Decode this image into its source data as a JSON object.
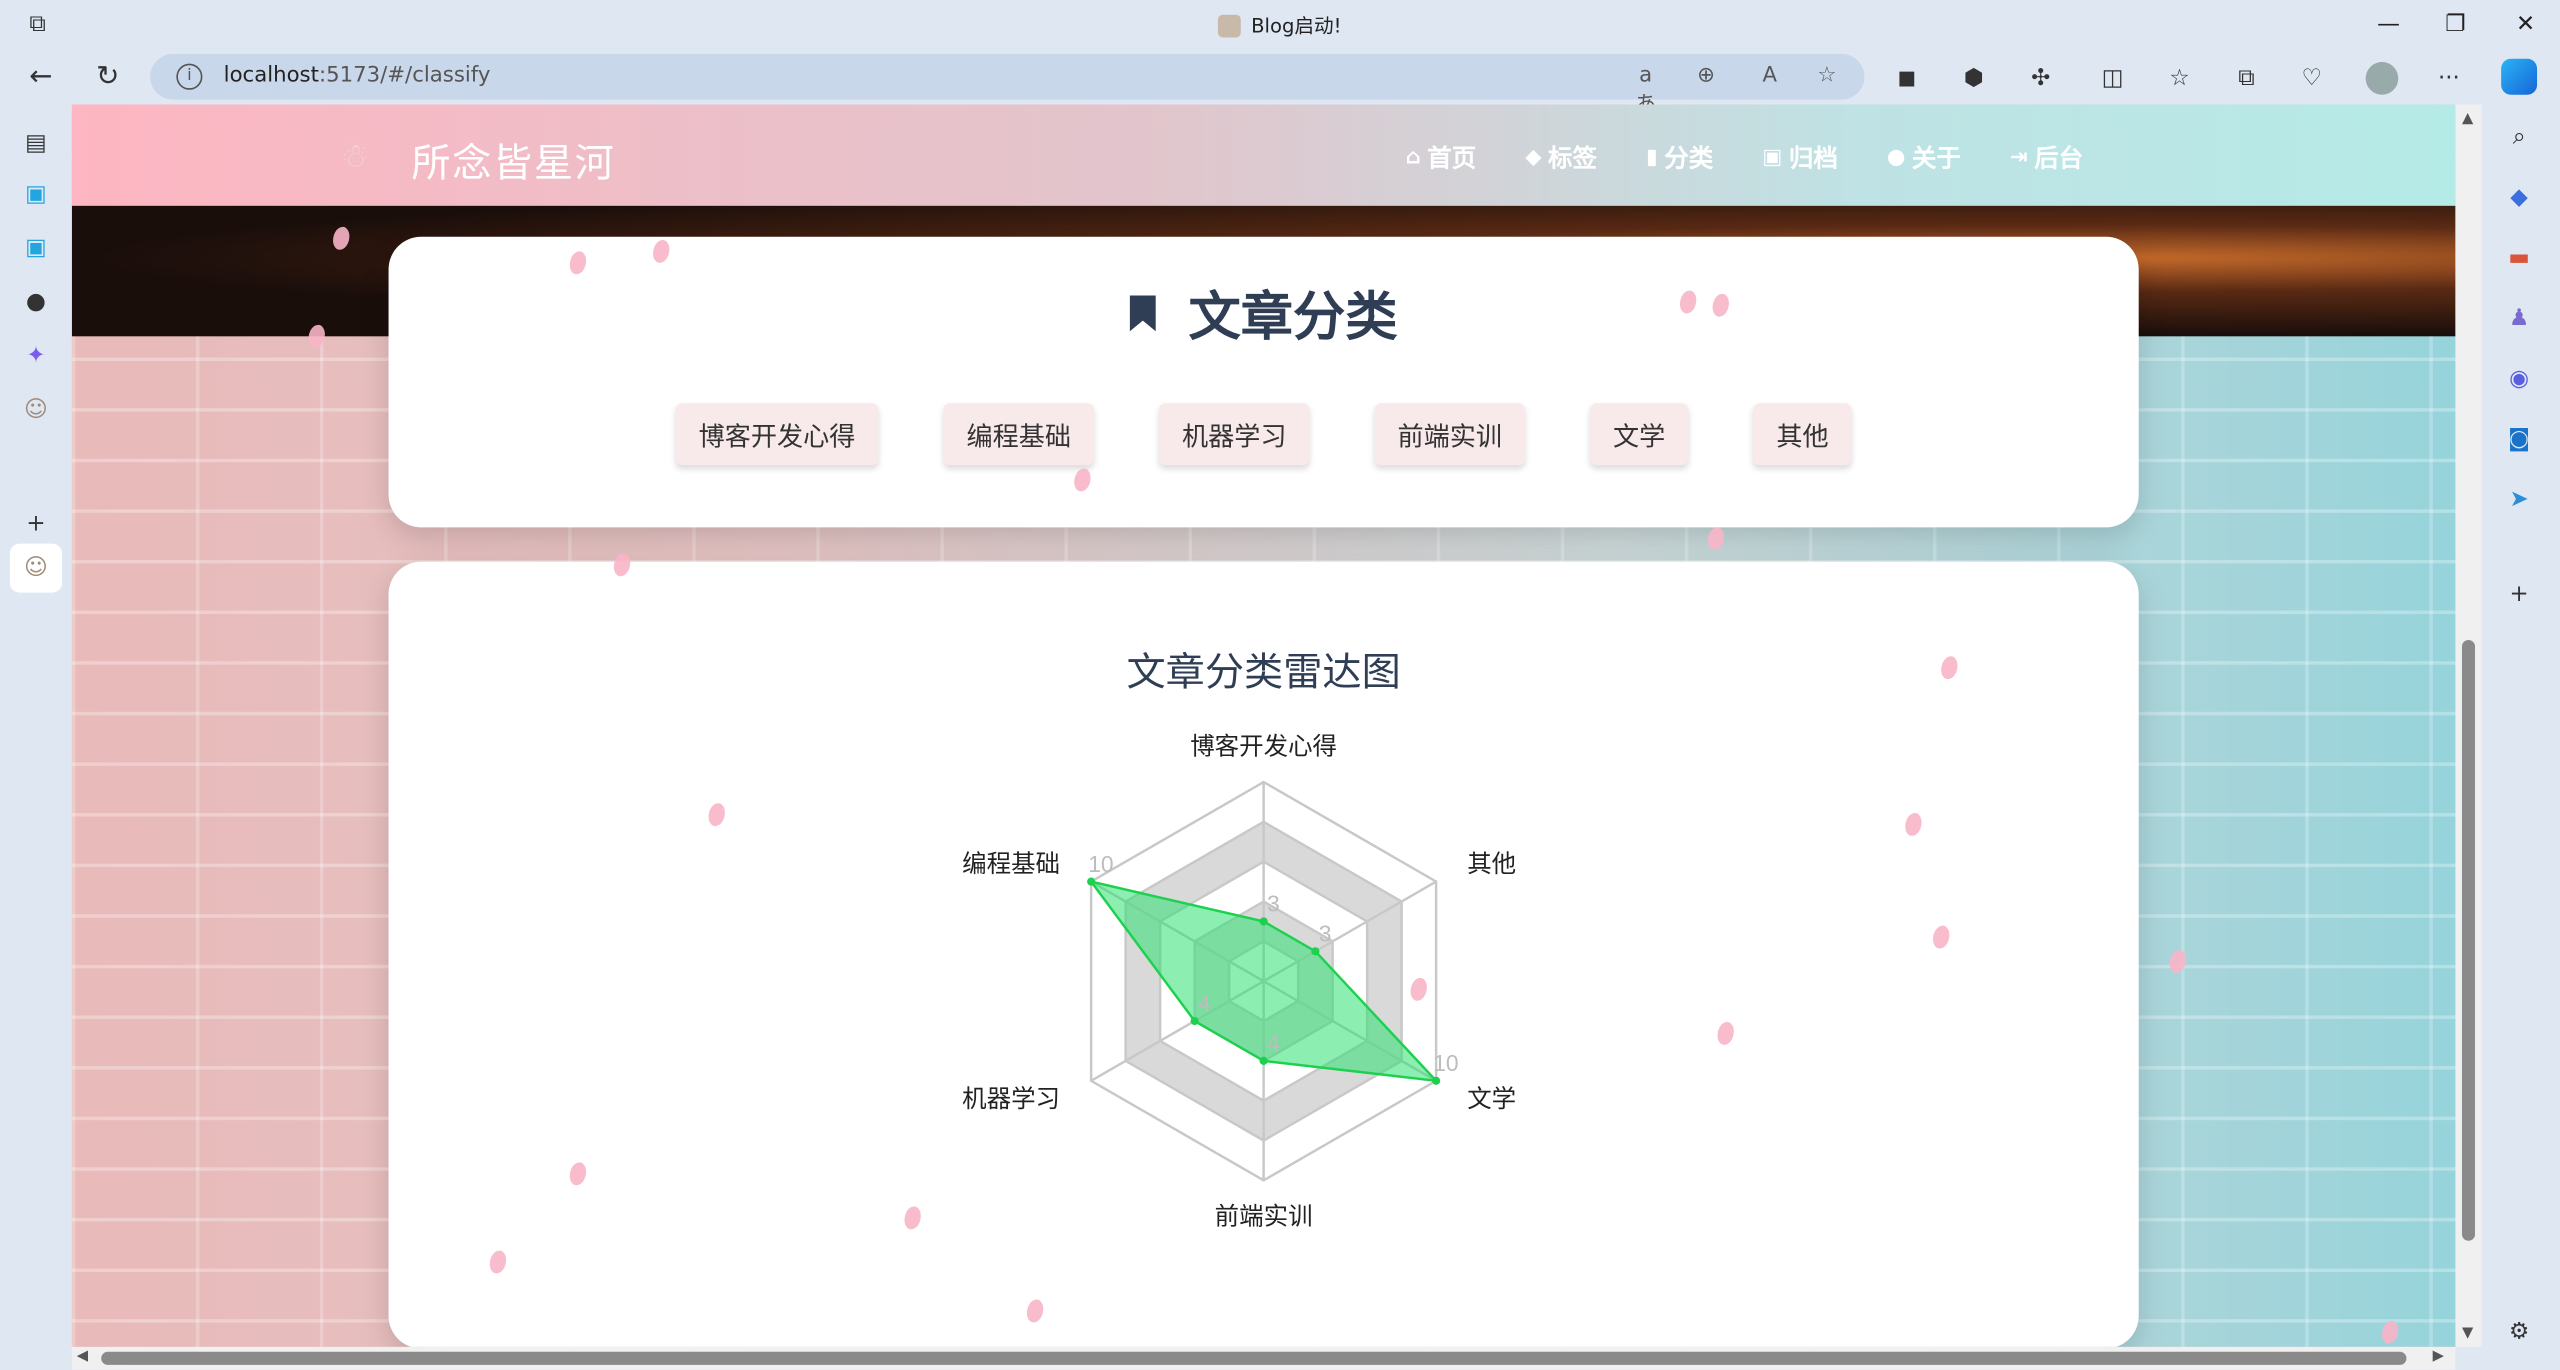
{
  "browser": {
    "window_title": "Blog启动!",
    "url_host": "localhost",
    "url_rest": ":5173/#/classify"
  },
  "site": {
    "title": "所念皆星河",
    "menu": [
      {
        "icon": "home-icon",
        "glyph": "⌂",
        "label": "首页"
      },
      {
        "icon": "tag-icon",
        "glyph": "◆",
        "label": "标签"
      },
      {
        "icon": "bookmark-icon",
        "glyph": "▮",
        "label": "分类"
      },
      {
        "icon": "archive-icon",
        "glyph": "▣",
        "label": "归档"
      },
      {
        "icon": "user-circle-icon",
        "glyph": "●",
        "label": "关于"
      },
      {
        "icon": "sign-in-icon",
        "glyph": "⇥",
        "label": "后台"
      }
    ]
  },
  "classify": {
    "heading": "文章分类",
    "categories": [
      "博客开发心得",
      "编程基础",
      "机器学习",
      "前端实训",
      "文学",
      "其他"
    ]
  },
  "chart_data": {
    "type": "radar",
    "title": "文章分类雷达图",
    "indicators": [
      "博客开发心得",
      "其他",
      "文学",
      "前端实训",
      "机器学习",
      "编程基础"
    ],
    "values": [
      3,
      3,
      10,
      4,
      4,
      10
    ],
    "max": 10,
    "color": "#1dd14f",
    "fill": "rgba(46,224,112,0.55)",
    "split_colors": [
      "#ffffff",
      "#d9d9d9"
    ]
  }
}
